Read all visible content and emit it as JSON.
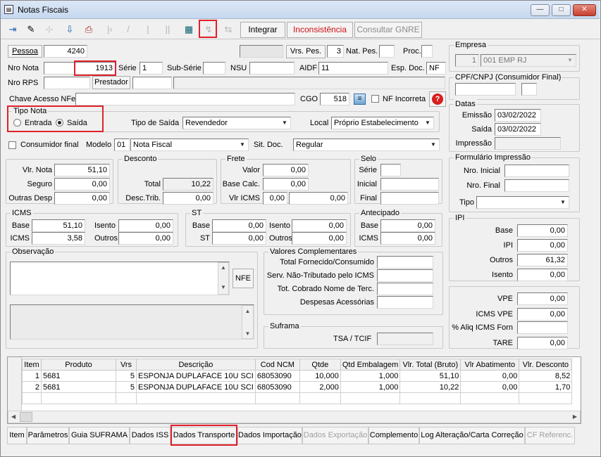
{
  "window": {
    "title": "Notas Fiscais",
    "min": "—",
    "max": "□",
    "close": "✕"
  },
  "toolbar": {
    "integrar": "Integrar",
    "inconsistencia": "Inconsistência",
    "consultar_gnre": "Consultar GNRE"
  },
  "colors": {
    "accent_red": "#e0202a",
    "inconsistencia_text": "#d01010"
  },
  "nota": {
    "pessoa_label": "Pessoa",
    "pessoa_value": "4240",
    "vrs_pes_label": "Vrs. Pes.",
    "vrs_pes_value": "3",
    "nat_pes_label": "Nat. Pes.",
    "nat_pes_value": "",
    "proc_label": "Proc.",
    "proc_value": "",
    "nro_nota_label": "Nro Nota",
    "nro_nota_value": "1913",
    "serie_label": "Série",
    "serie_value": "1",
    "sub_serie_label": "Sub-Série",
    "sub_serie_value": "",
    "nsu_label": "NSU",
    "nsu_value": "",
    "aidf_label": "AIDF",
    "aidf_value": "11",
    "esp_doc_label": "Esp. Doc.",
    "esp_doc_value": "NF",
    "nro_rps_label": "Nro RPS",
    "prestador_label": "Prestador",
    "chave_label": "Chave Acesso NFe",
    "chave_value": "",
    "cgo_label": "CGO",
    "cgo_value": "518",
    "nf_incorreta_label": "NF Incorreta",
    "tipo_nota_label": "Tipo Nota",
    "entrada_label": "Entrada",
    "saida_label": "Saída",
    "tipo_saida_label": "Tipo de Saída",
    "tipo_saida_value": "Revendedor",
    "local_label": "Local",
    "local_value": "Próprio Estabelecimento",
    "consumidor_label": "Consumidor final",
    "modelo_label": "Modelo",
    "modelo_code": "01",
    "modelo_value": "Nota Fiscal",
    "sit_doc_label": "Sit. Doc.",
    "sit_doc_value": "Regular"
  },
  "empresa": {
    "title": "Empresa",
    "num": "1",
    "name": "001 EMP RJ"
  },
  "cpf": {
    "title": "CPF/CNPJ (Consumidor Final)"
  },
  "datas": {
    "title": "Datas",
    "emissao_label": "Emissão",
    "emissao_value": "03/02/2022",
    "saida_label": "Saída",
    "saida_value": "03/02/2022",
    "impressao_label": "Impressão"
  },
  "valores": {
    "vlr_nota_label": "Vlr. Nota",
    "vlr_nota": "51,10",
    "seguro_label": "Seguro",
    "seguro": "0,00",
    "outras_label": "Outras Desp",
    "outras": "0,00"
  },
  "desconto": {
    "title": "Desconto",
    "total_label": "Total",
    "total": "10,22",
    "desc_trib_label": "Desc.Trib.",
    "desc_trib": "0,00"
  },
  "frete": {
    "title": "Frete",
    "valor_label": "Valor",
    "valor": "0,00",
    "base_label": "Base Calc.",
    "base": "0,00",
    "icms_label": "Vlr ICMS",
    "icms_a": "0,00",
    "icms_b": "0,00"
  },
  "selo": {
    "title": "Selo",
    "serie_label": "Série",
    "inicial_label": "Inicial",
    "final_label": "Final"
  },
  "formulario": {
    "title": "Formulário Impressão",
    "inicial_label": "Nro. Inicial",
    "final_label": "Nro. Final",
    "tipo_label": "Tipo"
  },
  "icms": {
    "title": "ICMS",
    "base_label": "Base",
    "base": "51,10",
    "icms_label": "ICMS",
    "icms": "3,58",
    "isento_label": "Isento",
    "isento": "0,00",
    "outros_label": "Outros",
    "outros": "0,00"
  },
  "st": {
    "title": "ST",
    "base_label": "Base",
    "base": "0,00",
    "st_label": "ST",
    "st": "0,00",
    "isento_label": "Isento",
    "isento": "0,00",
    "outros_label": "Outros",
    "outros": "0,00"
  },
  "antecipado": {
    "title": "Antecipado",
    "base_label": "Base",
    "base": "0,00",
    "icms_label": "ICMS",
    "icms": "0,00"
  },
  "ipi": {
    "title": "IPI",
    "base_label": "Base",
    "base": "0,00",
    "ipi_label": "IPI",
    "ipi": "0,00",
    "outros_label": "Outros",
    "outros": "61,32",
    "isento_label": "Isento",
    "isento": "0,00"
  },
  "vpe": {
    "vpe_label": "VPE",
    "vpe": "0,00",
    "icms_vpe_label": "ICMS VPE",
    "icms_vpe": "0,00",
    "aliq_label": "% Aliq ICMS Forn",
    "aliq": "",
    "tare_label": "TARE",
    "tare": "0,00"
  },
  "observacao": {
    "title": "Observação",
    "nfe_button": "NFE"
  },
  "complementares": {
    "title": "Valores Complementares",
    "total_label": "Total Fornecido/Consumido",
    "serv_label": "Serv. Não-Tributado pelo ICMS",
    "tot_label": "Tot. Cobrado Nome de Terc.",
    "desp_label": "Despesas Acessórias"
  },
  "suframa": {
    "title": "Suframa",
    "tsa_label": "TSA / TCIF"
  },
  "grid": {
    "headers": [
      "Item",
      "Produto",
      "Vrs",
      "Descrição",
      "Cod NCM",
      "Qtde",
      "Qtd Embalagem",
      "Vlr. Total (Bruto)",
      "Vlr Abatimento",
      "Vlr. Desconto"
    ],
    "rows": [
      [
        "1",
        "5681",
        "5",
        "ESPONJA DUPLAFACE 10U SCI",
        "68053090",
        "10,000",
        "1,000",
        "51,10",
        "0,00",
        "8,52"
      ],
      [
        "2",
        "5681",
        "5",
        "ESPONJA DUPLAFACE 10U SCI",
        "68053090",
        "2,000",
        "1,000",
        "10,22",
        "0,00",
        "1,70"
      ]
    ]
  },
  "tabs": [
    "Item",
    "Parâmetros",
    "Guia SUFRAMA",
    "Dados ISS",
    "Dados Transporte",
    "Dados Importação",
    "Dados Exportação",
    "Complemento",
    "Log Alteração/Carta Correção",
    "CF Referenc."
  ]
}
